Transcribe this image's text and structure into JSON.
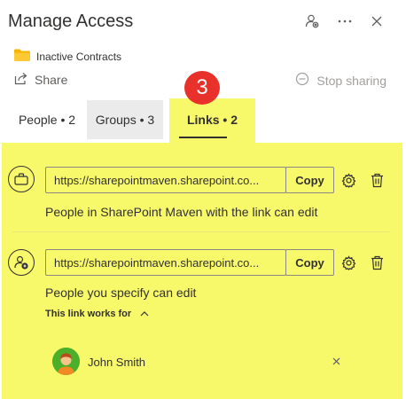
{
  "dialog": {
    "title": "Manage Access"
  },
  "header_icons": [
    "person-settings-icon",
    "more-icon",
    "close-icon"
  ],
  "item": {
    "name": "Inactive Contracts",
    "icon": "folder-icon",
    "folder_color": "#f5b400"
  },
  "actions": {
    "share_label": "Share",
    "stop_sharing_label": "Stop sharing"
  },
  "tabs": [
    {
      "label": "People • 2"
    },
    {
      "label": "Groups • 3"
    },
    {
      "label": "Links • 2"
    }
  ],
  "callout": {
    "number": "3",
    "color": "#e8312a"
  },
  "highlight_color": "#f8f86b",
  "links": [
    {
      "icon": "briefcase-icon",
      "url": "https://sharepointmaven.sharepoint.co...",
      "copy_label": "Copy",
      "description": "People in SharePoint Maven with the link can edit"
    },
    {
      "icon": "person-add-icon",
      "url": "https://sharepointmaven.sharepoint.co...",
      "copy_label": "Copy",
      "description": "People you specify can edit",
      "works_for_label": "This link works for",
      "people": [
        {
          "name": "John Smith"
        }
      ]
    }
  ]
}
